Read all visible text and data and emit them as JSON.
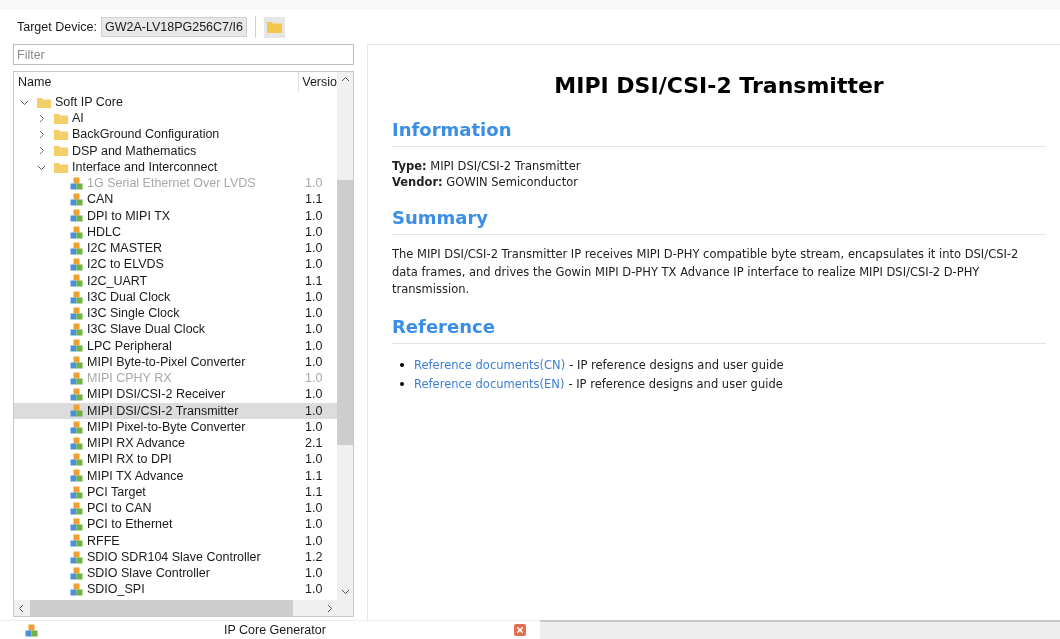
{
  "toolbar": {
    "label": "Target Device:",
    "device": "GW2A-LV18PG256C7/I6"
  },
  "filter": {
    "placeholder": "Filter"
  },
  "tree": {
    "columns": [
      "Name",
      "Versio"
    ],
    "items": [
      {
        "kind": "folder",
        "name": "Soft IP Core",
        "expanded": true,
        "children": [
          {
            "kind": "folder",
            "name": "AI",
            "expanded": false
          },
          {
            "kind": "folder",
            "name": "BackGround Configuration",
            "expanded": false
          },
          {
            "kind": "folder",
            "name": "DSP and Mathematics",
            "expanded": false
          },
          {
            "kind": "folder",
            "name": "Interface and Interconnect",
            "expanded": true,
            "children": [
              {
                "kind": "ip",
                "name": "1G Serial Ethernet Over LVDS",
                "version": "1.0",
                "disabled": true,
                "selected": false
              },
              {
                "kind": "ip",
                "name": "CAN",
                "version": "1.1",
                "disabled": false,
                "selected": false
              },
              {
                "kind": "ip",
                "name": "DPI to MIPI TX",
                "version": "1.0",
                "disabled": false,
                "selected": false
              },
              {
                "kind": "ip",
                "name": "HDLC",
                "version": "1.0",
                "disabled": false,
                "selected": false
              },
              {
                "kind": "ip",
                "name": "I2C MASTER",
                "version": "1.0",
                "disabled": false,
                "selected": false
              },
              {
                "kind": "ip",
                "name": "I2C to ELVDS",
                "version": "1.0",
                "disabled": false,
                "selected": false
              },
              {
                "kind": "ip",
                "name": "I2C_UART",
                "version": "1.1",
                "disabled": false,
                "selected": false
              },
              {
                "kind": "ip",
                "name": "I3C Dual Clock",
                "version": "1.0",
                "disabled": false,
                "selected": false
              },
              {
                "kind": "ip",
                "name": "I3C Single Clock",
                "version": "1.0",
                "disabled": false,
                "selected": false
              },
              {
                "kind": "ip",
                "name": "I3C Slave Dual Clock",
                "version": "1.0",
                "disabled": false,
                "selected": false
              },
              {
                "kind": "ip",
                "name": "LPC Peripheral",
                "version": "1.0",
                "disabled": false,
                "selected": false
              },
              {
                "kind": "ip",
                "name": "MIPI Byte-to-Pixel Converter",
                "version": "1.0",
                "disabled": false,
                "selected": false
              },
              {
                "kind": "ip",
                "name": "MIPI CPHY RX",
                "version": "1.0",
                "disabled": true,
                "selected": false
              },
              {
                "kind": "ip",
                "name": "MIPI DSI/CSI-2 Receiver",
                "version": "1.0",
                "disabled": false,
                "selected": false
              },
              {
                "kind": "ip",
                "name": "MIPI DSI/CSI-2 Transmitter",
                "version": "1.0",
                "disabled": false,
                "selected": true
              },
              {
                "kind": "ip",
                "name": "MIPI Pixel-to-Byte Converter",
                "version": "1.0",
                "disabled": false,
                "selected": false
              },
              {
                "kind": "ip",
                "name": "MIPI RX Advance",
                "version": "2.1",
                "disabled": false,
                "selected": false
              },
              {
                "kind": "ip",
                "name": "MIPI RX to DPI",
                "version": "1.0",
                "disabled": false,
                "selected": false
              },
              {
                "kind": "ip",
                "name": "MIPI TX Advance",
                "version": "1.1",
                "disabled": false,
                "selected": false
              },
              {
                "kind": "ip",
                "name": "PCI Target",
                "version": "1.1",
                "disabled": false,
                "selected": false
              },
              {
                "kind": "ip",
                "name": "PCI to CAN",
                "version": "1.0",
                "disabled": false,
                "selected": false
              },
              {
                "kind": "ip",
                "name": "PCI to Ethernet",
                "version": "1.0",
                "disabled": false,
                "selected": false
              },
              {
                "kind": "ip",
                "name": "RFFE",
                "version": "1.0",
                "disabled": false,
                "selected": false
              },
              {
                "kind": "ip",
                "name": "SDIO SDR104 Slave Controller",
                "version": "1.2",
                "disabled": false,
                "selected": false
              },
              {
                "kind": "ip",
                "name": "SDIO Slave Controller",
                "version": "1.0",
                "disabled": false,
                "selected": false
              },
              {
                "kind": "ip",
                "name": "SDIO_SPI",
                "version": "1.0",
                "disabled": false,
                "selected": false
              }
            ]
          }
        ]
      }
    ]
  },
  "doc": {
    "title": "MIPI DSI/CSI-2 Transmitter",
    "sections": [
      {
        "heading": "Information",
        "kind": "fields",
        "fields": [
          {
            "label": "Type:",
            "value": "MIPI DSI/CSI-2 Transmitter"
          },
          {
            "label": "Vendor:",
            "value": "GOWIN Semiconductor"
          }
        ]
      },
      {
        "heading": "Summary",
        "kind": "text",
        "text": "The MIPI DSI/CSI-2 Transmitter IP receives MIPI D-PHY compatible byte stream, encapsulates it into DSI/CSI-2 data frames, and drives the Gowin MIPI D-PHY TX Advance IP interface to realize MIPI DSI/CSI-2 D-PHY transmission."
      },
      {
        "heading": "Reference",
        "kind": "links",
        "links": [
          {
            "link": "Reference documents(CN)",
            "text": "- IP reference designs and user guide"
          },
          {
            "link": "Reference documents(EN)",
            "text": "- IP reference designs and user guide"
          }
        ]
      }
    ]
  },
  "bottom_tab": {
    "title": "IP Core Generator"
  }
}
